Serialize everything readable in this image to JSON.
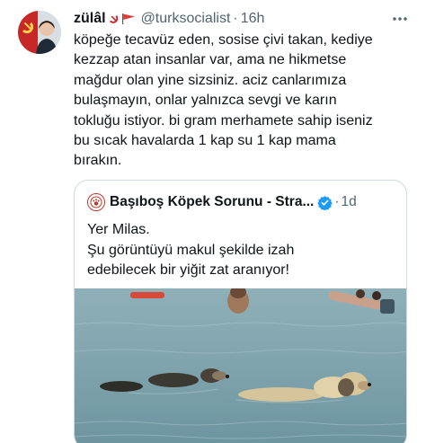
{
  "tweet": {
    "display_name": "zülâl",
    "handle": "@turksocialist",
    "separator": "·",
    "time": "16h",
    "more_icon": "more-horizontal-icon",
    "avatar_icon": "hammer-sickle-avatar",
    "name_emojis": [
      "hammer-sickle-emoji",
      "red-flag-emoji"
    ],
    "body_lines": [
      "köpeğe tecavüz eden, sosise çivi takan, kediye",
      "kezzap atan insanlar var, ama ne hikmetse",
      "mağdur olan yine sizsiniz. aciz canlarımıza",
      "bulaşmayın, onlar yalnızca sevgi ve karın",
      "tokluğu istiyor. bi gram merhamete sahip iseniz",
      "bu sıcak havalarda 1 kap su 1 kap mama",
      "bırakın."
    ]
  },
  "quote": {
    "display_name": "Başıboş Köpek Sorunu - Stra...",
    "verified_icon": "verified-badge-icon",
    "separator": "·",
    "time": "1d",
    "text_lines": [
      "Yer Milas.",
      "Şu görüntüyü makul şekilde izah",
      "edebilecek bir yiğit zat aranıyor!"
    ],
    "media": {
      "description_icon": "sea-photo",
      "colors": {
        "water": "#7fa3ad",
        "water_dark": "#5d8793"
      }
    }
  },
  "colors": {
    "text": "#0f1419",
    "secondary": "#536471",
    "border": "#cfd9de",
    "verified": "#1d9bf0"
  }
}
